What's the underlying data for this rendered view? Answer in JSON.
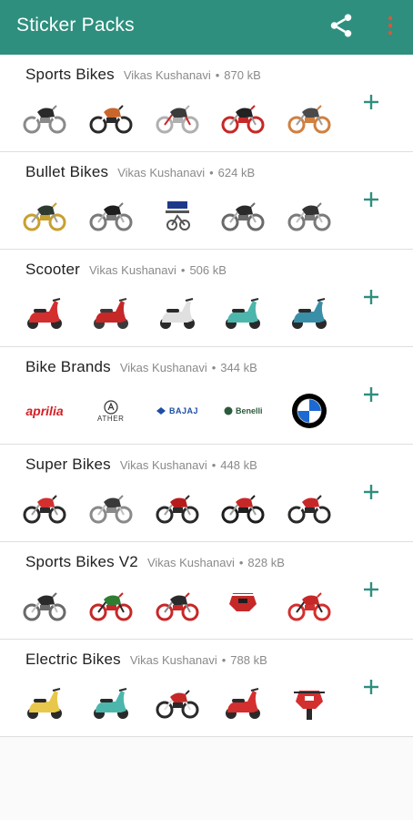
{
  "appbar": {
    "title": "Sticker Packs",
    "bg_color": "#2e8f7e",
    "share_icon": "share-icon",
    "more_icon": "more-vert-icon"
  },
  "accent_color": "#2e8f7e",
  "packs": [
    {
      "name": "Sports Bikes",
      "author": "Vikas Kushanavi",
      "separator": "•",
      "size": "870 kB",
      "stickers": [
        {
          "kind": "motorcycle",
          "colors": [
            "#2a2a2a",
            "#8a8a8a",
            "#ffffff"
          ]
        },
        {
          "kind": "motorcycle",
          "colors": [
            "#c8662c",
            "#2a2a2a",
            "#ffffff"
          ]
        },
        {
          "kind": "motorcycle",
          "colors": [
            "#3b3b3b",
            "#b0b0b0",
            "#c62828"
          ]
        },
        {
          "kind": "motorcycle",
          "colors": [
            "#222222",
            "#c62828",
            "#9e9e9e"
          ]
        },
        {
          "kind": "motorcycle",
          "colors": [
            "#4a4a4a",
            "#d08040",
            "#9e9e9e"
          ]
        }
      ]
    },
    {
      "name": "Bullet Bikes",
      "author": "Vikas Kushanavi",
      "separator": "•",
      "size": "624 kB",
      "stickers": [
        {
          "kind": "motorcycle",
          "colors": [
            "#2f3b2f",
            "#c8a030",
            "#9e9e9e"
          ]
        },
        {
          "kind": "motorcycle",
          "colors": [
            "#1e1e1e",
            "#7a7a7a",
            "#b0b0b0"
          ]
        },
        {
          "kind": "text-sticker",
          "colors": [
            "#1d3a8a",
            "#555555",
            "#ffffff"
          ]
        },
        {
          "kind": "motorcycle",
          "colors": [
            "#2a2a2a",
            "#6a6a6a",
            "#b0b0b0"
          ]
        },
        {
          "kind": "motorcycle",
          "colors": [
            "#333333",
            "#7a7a7a",
            "#c0c0c0"
          ]
        }
      ]
    },
    {
      "name": "Scooter",
      "author": "Vikas Kushanavi",
      "separator": "•",
      "size": "506 kB",
      "stickers": [
        {
          "kind": "scooter",
          "colors": [
            "#d32f2f",
            "#2a2a2a",
            "#ffffff"
          ]
        },
        {
          "kind": "scooter",
          "colors": [
            "#c62828",
            "#3a3a3a",
            "#9e9e9e"
          ]
        },
        {
          "kind": "scooter",
          "colors": [
            "#e0e0e0",
            "#2a2a2a",
            "#9e9e9e"
          ]
        },
        {
          "kind": "scooter",
          "colors": [
            "#4db6ac",
            "#2a2a2a",
            "#e0e0e0"
          ]
        },
        {
          "kind": "scooter",
          "colors": [
            "#3a8fa8",
            "#2a2a2a",
            "#e0e0e0"
          ]
        }
      ]
    },
    {
      "name": "Bike Brands",
      "author": "Vikas Kushanavi",
      "separator": "•",
      "size": "344 kB",
      "stickers": [
        {
          "kind": "brand-aprilia",
          "colors": [
            "#d41f25"
          ]
        },
        {
          "kind": "brand-ather",
          "colors": [
            "#333333"
          ]
        },
        {
          "kind": "brand-bajaj",
          "colors": [
            "#1d4fa3"
          ]
        },
        {
          "kind": "brand-benelli",
          "colors": [
            "#2b5a3c"
          ]
        },
        {
          "kind": "brand-bmw",
          "colors": [
            "#1c69d4",
            "#000000",
            "#ffffff"
          ]
        }
      ]
    },
    {
      "name": "Super Bikes",
      "author": "Vikas Kushanavi",
      "separator": "•",
      "size": "448 kB",
      "stickers": [
        {
          "kind": "motorcycle",
          "colors": [
            "#d32f2f",
            "#2a2a2a",
            "#9e9e9e"
          ]
        },
        {
          "kind": "motorcycle",
          "colors": [
            "#3a3a3a",
            "#8a8a8a",
            "#c0c0c0"
          ]
        },
        {
          "kind": "motorcycle",
          "colors": [
            "#b71c1c",
            "#2a2a2a",
            "#9e9e9e"
          ]
        },
        {
          "kind": "motorcycle",
          "colors": [
            "#c62828",
            "#1e1e1e",
            "#9e9e9e"
          ]
        },
        {
          "kind": "motorcycle",
          "colors": [
            "#c62828",
            "#2a2a2a",
            "#ffffff"
          ]
        }
      ]
    },
    {
      "name": "Sports Bikes V2",
      "author": "Vikas Kushanavi",
      "separator": "•",
      "size": "828 kB",
      "stickers": [
        {
          "kind": "motorcycle",
          "colors": [
            "#2a2a2a",
            "#6a6a6a",
            "#c0c0c0"
          ]
        },
        {
          "kind": "motorcycle",
          "colors": [
            "#2e7d32",
            "#c62828",
            "#2a2a2a"
          ]
        },
        {
          "kind": "motorcycle",
          "colors": [
            "#2a2a2a",
            "#c62828",
            "#8a8a8a"
          ]
        },
        {
          "kind": "front-bike",
          "colors": [
            "#c62828",
            "#1e1e1e",
            "#ffffff"
          ]
        },
        {
          "kind": "motorcycle",
          "colors": [
            "#c62828",
            "#d32f2f",
            "#2a2a2a"
          ]
        }
      ]
    },
    {
      "name": "Electric Bikes",
      "author": "Vikas Kushanavi",
      "separator": "•",
      "size": "788 kB",
      "stickers": [
        {
          "kind": "scooter",
          "colors": [
            "#e8c84a",
            "#2a2a2a",
            "#ffffff"
          ]
        },
        {
          "kind": "scooter",
          "colors": [
            "#4db6ac",
            "#2a2a2a",
            "#e0e0e0"
          ]
        },
        {
          "kind": "motorcycle",
          "colors": [
            "#c62828",
            "#2a2a2a",
            "#e0e0e0"
          ]
        },
        {
          "kind": "scooter",
          "colors": [
            "#d32f2f",
            "#2a2a2a",
            "#e0e0e0"
          ]
        },
        {
          "kind": "front-scooter",
          "colors": [
            "#d32f2f",
            "#ffffff",
            "#2a2a2a"
          ]
        }
      ]
    }
  ]
}
